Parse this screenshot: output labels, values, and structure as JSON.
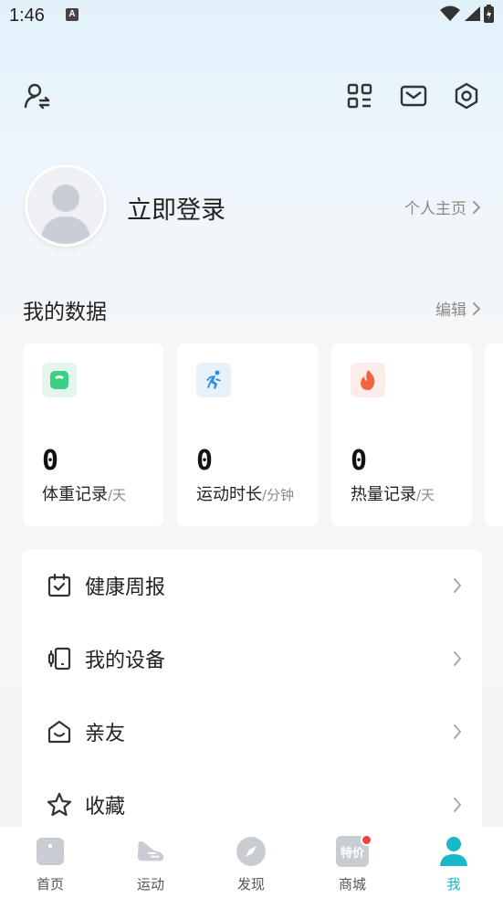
{
  "status_bar": {
    "time": "1:46",
    "notification_glyph": "A"
  },
  "profile": {
    "login_label": "立即登录",
    "homepage_label": "个人主页"
  },
  "my_data": {
    "title": "我的数据",
    "edit_label": "编辑",
    "cards": [
      {
        "value": "0",
        "label": "体重记录",
        "unit": "/天",
        "icon": "scale-icon",
        "icon_bg": "#e3f5ec",
        "icon_color": "#3ccf85"
      },
      {
        "value": "0",
        "label": "运动时长",
        "unit": "/分钟",
        "icon": "running-icon",
        "icon_bg": "#e6f1fb",
        "icon_color": "#2f8fe8"
      },
      {
        "value": "0",
        "label": "热量记录",
        "unit": "/天",
        "icon": "flame-icon",
        "icon_bg": "#fdecea",
        "icon_color": "#f2643e"
      }
    ]
  },
  "menu": [
    {
      "label": "健康周报",
      "icon": "calendar-check-icon"
    },
    {
      "label": "我的设备",
      "icon": "device-icon"
    },
    {
      "label": "亲友",
      "icon": "smile-home-icon"
    },
    {
      "label": "收藏",
      "icon": "star-icon"
    }
  ],
  "bottom_nav": [
    {
      "label": "首页",
      "icon": "home-icon",
      "active": false
    },
    {
      "label": "运动",
      "icon": "sneaker-icon",
      "active": false
    },
    {
      "label": "发现",
      "icon": "compass-icon",
      "active": false
    },
    {
      "label": "商城",
      "icon": "shop-icon",
      "badge_text": "特价",
      "active": false
    },
    {
      "label": "我",
      "icon": "user-icon",
      "active": true
    }
  ],
  "colors": {
    "accent": "#19b8c8",
    "badge_red": "#f04438"
  }
}
